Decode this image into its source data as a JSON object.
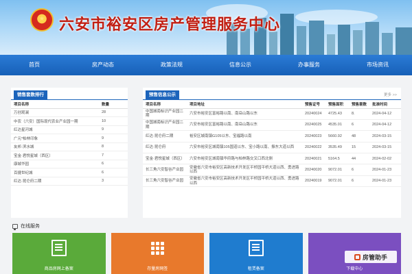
{
  "header": {
    "title": "六安市裕安区房产管理服务中心"
  },
  "nav": [
    "首页",
    "房产动态",
    "政策法规",
    "信息公示",
    "办事服务",
    "市场资讯"
  ],
  "sales_rank": {
    "tag": "销售套数排行",
    "columns": [
      "项目名称",
      "数量"
    ],
    "rows": [
      [
        "万创观澜",
        "28"
      ],
      [
        "中农（六安）国际现代农业产业园一期",
        "10"
      ],
      [
        "红达星河城",
        "9"
      ],
      [
        "广元*柏林印象",
        "9"
      ],
      [
        "友邦·滨水城",
        "8"
      ],
      [
        "宝金·君悦星城（西区）",
        "7"
      ],
      [
        "康城华园",
        "6"
      ],
      [
        "百捷世纪城",
        "6"
      ],
      [
        "红达·昆仑府二期",
        "3"
      ]
    ]
  },
  "presale": {
    "tag": "预售信息公示",
    "more": "更多 >>",
    "columns": [
      "项目名称",
      "项目地址",
      "预售证号",
      "预售面积",
      "预售套数",
      "批准时间"
    ],
    "rows": [
      [
        "中国城南标识产业园二期",
        "六安市裕安区富裕路以南、南岳山路以东",
        "20240024",
        "4725.43",
        "8.",
        "2024-04-12"
      ],
      [
        "中国城南标识产业园二期",
        "六安市裕安区富裕路以南、南岳山路以东",
        "20240025",
        "4535.01",
        "6",
        "2024-04-12"
      ],
      [
        "红达·昆仑府二期",
        "裕安区城南镇G105以东、宝福路以南",
        "20240023",
        "5660.92",
        "48",
        "2024-03-15"
      ],
      [
        "红达·昆仑府",
        "六安市裕安区城南镇105国道以东、宝小路以南、振东大道以西",
        "20240022",
        "3535.49",
        "15",
        "2024-03-15"
      ],
      [
        "宝金·君悦星城（西区）",
        "六安市裕安区城南镇华府路与柏林路交叉口西北侧",
        "20240021",
        "5164.5",
        "44",
        "2024-02-02"
      ],
      [
        "长三角六安智谷产业园",
        "安徽省六安市裕安区高新技术开发区平桥园平桥大道以西、勇进路以西",
        "20240020",
        "9072.01",
        "6",
        "2024-01-23"
      ],
      [
        "长三角六安智谷产业园",
        "安徽省六安市裕安区高新技术开发区平桥园平桥大道以西、勇进路以西",
        "20240019",
        "9072.01",
        "6",
        "2024-01-23"
      ]
    ]
  },
  "services": {
    "title": "在线服务",
    "items": [
      {
        "label": "商品房网上备案",
        "color": "#5aaa3a",
        "icon": "document-icon"
      },
      {
        "label": "存量房网签",
        "color": "#e8792c",
        "icon": "grid-icon"
      },
      {
        "label": "租赁备案",
        "color": "#1f7ccf",
        "icon": "document-icon"
      },
      {
        "label": "下载中心",
        "color": "#7b4fc0",
        "icon": "download-icon"
      }
    ]
  },
  "watermark": "房管助手"
}
